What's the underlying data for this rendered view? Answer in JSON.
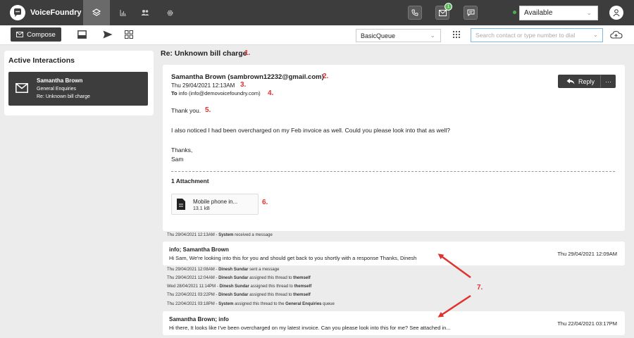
{
  "app": {
    "name": "VoiceFoundry"
  },
  "nav": {
    "tabs": [
      "layers",
      "reports",
      "users",
      "settings"
    ]
  },
  "topbar": {
    "notification_count": "1",
    "status": "Available"
  },
  "toolbar": {
    "compose_label": "Compose",
    "queue": "BasicQueue",
    "dial_placeholder": "Search contact or type number to dial"
  },
  "left_panel": {
    "title": "Active Interactions",
    "card": {
      "name": "Samantha Brown",
      "queue": "General Enquiries",
      "subject": "Re: Unknown bill charge"
    }
  },
  "email": {
    "subject": "Re: Unknown bill charge",
    "sender": "Samantha Brown (sambrown12232@gmail.com)",
    "date": "Thu 29/04/2021 12:13AM",
    "to_label": "To",
    "to_value": "info (info@demovoicefoundry.com)",
    "reply_label": "Reply",
    "more_label": "···",
    "body": {
      "greeting": "Thank you.",
      "para": "I also noticed I had been overcharged on my Feb invoice as well. Could you please look into that as well?",
      "signoff": "Thanks,",
      "name": "Sam"
    },
    "attachment_heading": "1 Attachment",
    "attachment": {
      "name": "Mobile phone in...",
      "size": "13.1 kB"
    }
  },
  "annotations": [
    "1.",
    "2.",
    "3.",
    "4.",
    "5.",
    "6.",
    "7."
  ],
  "timeline": {
    "e1": {
      "time": "Thu 29/04/2021 12:13AM - ",
      "actor": "System",
      "text": " received a message"
    },
    "thread1": {
      "from": "info; Samantha Brown",
      "preview": "Hi Sam, We're looking into this for you and should get back to you shortly with a response Thanks, Dinesh",
      "date": "Thu 29/04/2021 12:09AM"
    },
    "e2": {
      "time": "Thu 29/04/2021 12:08AM - ",
      "actor": "Dinesh Sundar",
      "text": " sent a message"
    },
    "e3": {
      "time": "Thu 29/04/2021 12:04AM - ",
      "actor": "Dinesh Sundar",
      "text": " assigned this thread to ",
      "target": "themself"
    },
    "e4": {
      "time": "Wed 28/04/2021 11:14PM - ",
      "actor": "Dinesh Sundar",
      "text": " assigned this thread to ",
      "target": "themself"
    },
    "e5": {
      "time": "Thu 22/04/2021 03:22PM - ",
      "actor": "Dinesh Sundar",
      "text": " assigned this thread to ",
      "target": "themself"
    },
    "e6": {
      "time": "Thu 22/04/2021 03:18PM - ",
      "actor": "System",
      "text": " assigned this thread to the ",
      "target": "General Enquiries",
      "suffix": " queue"
    },
    "thread2": {
      "from": "Samantha Brown; info",
      "preview": "Hi there, It looks like I've been overcharged on my latest invoice. Can you please look into this for me? See attached in...",
      "date": "Thu 22/04/2021 03:17PM"
    }
  },
  "colors": {
    "annotation": "#e0322f",
    "dark": "#3d3d3d",
    "status": "#4caf50"
  }
}
